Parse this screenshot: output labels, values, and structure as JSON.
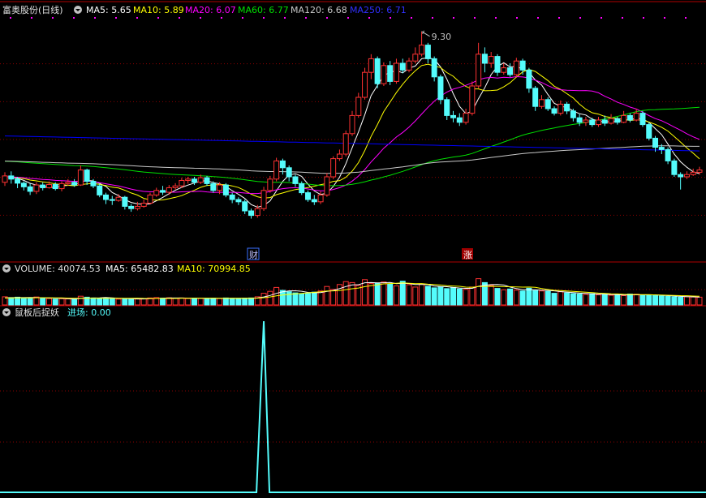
{
  "header": {
    "title": "富奥股份(日线)",
    "ma5": "MA5: 5.65",
    "ma10": "MA10: 5.89",
    "ma20": "MA20: 6.07",
    "ma60": "MA60: 6.77",
    "ma120": "MA120: 6.68",
    "ma250": "MA250: 6.71"
  },
  "volume_header": {
    "volume": "VOLUME: 40074.53",
    "ma5": "MA5: 65482.83",
    "ma10": "MA10: 70994.85"
  },
  "indicator_header": {
    "name": "鼠板后捉妖",
    "value": "进场: 0.00"
  },
  "markers": {
    "cai": "财",
    "zhang": "涨"
  },
  "peak_label": "9.30",
  "colors": {
    "up": "#ff3232",
    "down": "#54fcfc",
    "ma5": "#ffffff",
    "ma10": "#ffff00",
    "ma20": "#ff00ff",
    "ma60": "#00e000",
    "ma120": "#c8c8c8",
    "ma250": "#0000ff",
    "grid": "#8b0000",
    "signal": "#54fcfc"
  },
  "chart_data": [
    {
      "type": "candlestick",
      "title": "富奥股份(日线)",
      "ylim": [
        4.6,
        9.6
      ],
      "peak": 9.3,
      "candles": [
        [
          5.98,
          6.12,
          6.2,
          5.9
        ],
        [
          6.12,
          6.05,
          6.22,
          5.95
        ],
        [
          6.05,
          5.96,
          6.1,
          5.85
        ],
        [
          5.96,
          5.88,
          6.0,
          5.8
        ],
        [
          5.88,
          5.78,
          5.95,
          5.7
        ],
        [
          5.78,
          5.92,
          5.98,
          5.72
        ],
        [
          5.92,
          5.86,
          5.98,
          5.8
        ],
        [
          5.86,
          5.93,
          6.0,
          5.84
        ],
        [
          5.93,
          5.84,
          5.98,
          5.8
        ],
        [
          5.84,
          5.95,
          6.0,
          5.78
        ],
        [
          5.95,
          5.98,
          6.05,
          5.9
        ],
        [
          5.98,
          5.92,
          6.05,
          5.88
        ],
        [
          5.92,
          6.25,
          6.35,
          5.9
        ],
        [
          6.25,
          6.0,
          6.28,
          5.92
        ],
        [
          6.0,
          5.9,
          6.05,
          5.85
        ],
        [
          5.9,
          5.7,
          5.94,
          5.65
        ],
        [
          5.7,
          5.6,
          5.75,
          5.5
        ],
        [
          5.6,
          5.58,
          5.68,
          5.48
        ],
        [
          5.58,
          5.65,
          5.72,
          5.55
        ],
        [
          5.65,
          5.45,
          5.68,
          5.38
        ],
        [
          5.45,
          5.4,
          5.5,
          5.33
        ],
        [
          5.4,
          5.45,
          5.55,
          5.36
        ],
        [
          5.45,
          5.52,
          5.6,
          5.42
        ],
        [
          5.52,
          5.7,
          5.75,
          5.5
        ],
        [
          5.7,
          5.8,
          5.86,
          5.66
        ],
        [
          5.8,
          5.76,
          5.9,
          5.7
        ],
        [
          5.76,
          5.86,
          5.92,
          5.7
        ],
        [
          5.86,
          5.9,
          5.96,
          5.82
        ],
        [
          5.9,
          6.02,
          6.08,
          5.85
        ],
        [
          6.02,
          6.05,
          6.1,
          5.95
        ],
        [
          6.05,
          5.98,
          6.1,
          5.92
        ],
        [
          5.98,
          6.08,
          6.15,
          5.94
        ],
        [
          6.08,
          5.95,
          6.12,
          5.9
        ],
        [
          5.95,
          5.8,
          6.0,
          5.75
        ],
        [
          5.8,
          5.92,
          5.98,
          5.72
        ],
        [
          5.92,
          5.7,
          5.96,
          5.65
        ],
        [
          5.7,
          5.6,
          5.75,
          5.52
        ],
        [
          5.6,
          5.55,
          5.65,
          5.48
        ],
        [
          5.55,
          5.35,
          5.6,
          5.28
        ],
        [
          5.35,
          5.25,
          5.4,
          5.18
        ],
        [
          5.25,
          5.4,
          5.48,
          5.2
        ],
        [
          5.4,
          5.8,
          5.88,
          5.35
        ],
        [
          5.8,
          6.05,
          6.12,
          5.75
        ],
        [
          6.05,
          6.45,
          6.52,
          6.0
        ],
        [
          6.45,
          6.3,
          6.5,
          6.15
        ],
        [
          6.3,
          6.1,
          6.35,
          6.0
        ],
        [
          6.1,
          5.95,
          6.15,
          5.88
        ],
        [
          5.95,
          5.75,
          6.0,
          5.7
        ],
        [
          5.75,
          5.6,
          5.8,
          5.55
        ],
        [
          5.6,
          5.55,
          5.7,
          5.48
        ],
        [
          5.55,
          5.7,
          5.78,
          5.5
        ],
        [
          5.7,
          6.1,
          6.18,
          5.66
        ],
        [
          6.1,
          6.5,
          6.55,
          6.05
        ],
        [
          6.5,
          6.6,
          6.7,
          6.45
        ],
        [
          6.6,
          7.05,
          7.12,
          6.55
        ],
        [
          7.05,
          7.45,
          7.55,
          7.0
        ],
        [
          7.45,
          7.85,
          7.95,
          7.4
        ],
        [
          7.85,
          8.4,
          8.5,
          7.8
        ],
        [
          8.4,
          8.7,
          8.8,
          8.25
        ],
        [
          8.7,
          8.15,
          8.75,
          8.05
        ],
        [
          8.15,
          8.55,
          8.62,
          8.1
        ],
        [
          8.55,
          8.2,
          8.65,
          8.12
        ],
        [
          8.2,
          8.6,
          8.7,
          8.15
        ],
        [
          8.6,
          8.45,
          8.7,
          8.38
        ],
        [
          8.45,
          8.65,
          8.72,
          8.4
        ],
        [
          8.65,
          8.8,
          8.95,
          8.6
        ],
        [
          8.8,
          9.0,
          9.3,
          8.75
        ],
        [
          9.0,
          8.7,
          9.05,
          8.6
        ],
        [
          8.7,
          8.3,
          8.75,
          8.2
        ],
        [
          8.3,
          7.8,
          8.35,
          7.7
        ],
        [
          7.8,
          7.45,
          7.85,
          7.35
        ],
        [
          7.45,
          7.4,
          7.55,
          7.3
        ],
        [
          7.4,
          7.3,
          7.5,
          7.22
        ],
        [
          7.3,
          7.5,
          7.6,
          7.25
        ],
        [
          7.5,
          8.1,
          8.2,
          7.45
        ],
        [
          8.1,
          8.8,
          9.05,
          8.05
        ],
        [
          8.8,
          8.6,
          8.95,
          8.4
        ],
        [
          8.6,
          8.75,
          8.85,
          8.5
        ],
        [
          8.75,
          8.4,
          8.8,
          8.32
        ],
        [
          8.4,
          8.5,
          8.6,
          8.35
        ],
        [
          8.5,
          8.35,
          8.6,
          8.3
        ],
        [
          8.35,
          8.65,
          8.72,
          8.3
        ],
        [
          8.65,
          8.45,
          8.7,
          8.35
        ],
        [
          8.45,
          8.05,
          8.5,
          7.95
        ],
        [
          8.05,
          7.65,
          8.1,
          7.55
        ],
        [
          7.65,
          7.8,
          7.9,
          7.6
        ],
        [
          7.8,
          7.6,
          7.85,
          7.55
        ],
        [
          7.6,
          7.5,
          7.65,
          7.45
        ],
        [
          7.5,
          7.7,
          7.78,
          7.45
        ],
        [
          7.7,
          7.55,
          7.75,
          7.48
        ],
        [
          7.55,
          7.4,
          7.6,
          7.32
        ],
        [
          7.4,
          7.3,
          7.48,
          7.22
        ],
        [
          7.3,
          7.35,
          7.42,
          7.22
        ],
        [
          7.35,
          7.25,
          7.4,
          7.2
        ],
        [
          7.25,
          7.35,
          7.42,
          7.2
        ],
        [
          7.35,
          7.28,
          7.45,
          7.22
        ],
        [
          7.28,
          7.38,
          7.48,
          7.25
        ],
        [
          7.38,
          7.3,
          7.42,
          7.25
        ],
        [
          7.3,
          7.45,
          7.55,
          7.28
        ],
        [
          7.45,
          7.35,
          7.5,
          7.3
        ],
        [
          7.35,
          7.5,
          7.6,
          7.32
        ],
        [
          7.5,
          7.25,
          7.55,
          7.2
        ],
        [
          7.25,
          6.95,
          7.3,
          6.9
        ],
        [
          6.95,
          6.75,
          7.0,
          6.65
        ],
        [
          6.75,
          6.7,
          6.82,
          6.6
        ],
        [
          6.7,
          6.45,
          6.75,
          6.38
        ],
        [
          6.45,
          6.15,
          6.5,
          6.1
        ],
        [
          6.15,
          6.1,
          6.2,
          5.82
        ],
        [
          6.1,
          6.15,
          6.22,
          6.05
        ],
        [
          6.15,
          6.2,
          6.28,
          6.12
        ],
        [
          6.2,
          6.25,
          6.32,
          6.15
        ]
      ]
    },
    {
      "type": "bar",
      "title": "VOLUME",
      "ylim": [
        0,
        150000
      ],
      "values": [
        42000,
        38000,
        40000,
        35000,
        36000,
        41000,
        34000,
        33000,
        30000,
        32000,
        31000,
        28000,
        45000,
        40000,
        36000,
        35000,
        37000,
        33000,
        30000,
        32000,
        29000,
        31000,
        33000,
        36000,
        38000,
        35000,
        37000,
        34000,
        36000,
        33000,
        35000,
        34000,
        32000,
        35000,
        33000,
        36000,
        34000,
        33000,
        35000,
        36000,
        42000,
        60000,
        70000,
        90000,
        75000,
        68000,
        62000,
        58000,
        60000,
        66000,
        72000,
        95000,
        80000,
        105000,
        120000,
        115000,
        100000,
        130000,
        110000,
        112000,
        118000,
        108000,
        98000,
        122000,
        104000,
        92000,
        108000,
        96000,
        88000,
        92000,
        84000,
        90000,
        82000,
        80000,
        92000,
        135000,
        115000,
        100000,
        85000,
        78000,
        82000,
        76000,
        72000,
        86000,
        74000,
        72000,
        70000,
        60000,
        68000,
        62000,
        58000,
        56000,
        54000,
        58000,
        52000,
        55000,
        50000,
        52000,
        48000,
        56000,
        55000,
        50000,
        52000,
        48000,
        46000,
        44000,
        42000,
        40000,
        42000,
        41000,
        40074
      ]
    },
    {
      "type": "line",
      "title": "鼠板后捉妖",
      "ylim": [
        0,
        1
      ],
      "series": [
        {
          "name": "进场",
          "spike_index": 41
        }
      ]
    }
  ]
}
